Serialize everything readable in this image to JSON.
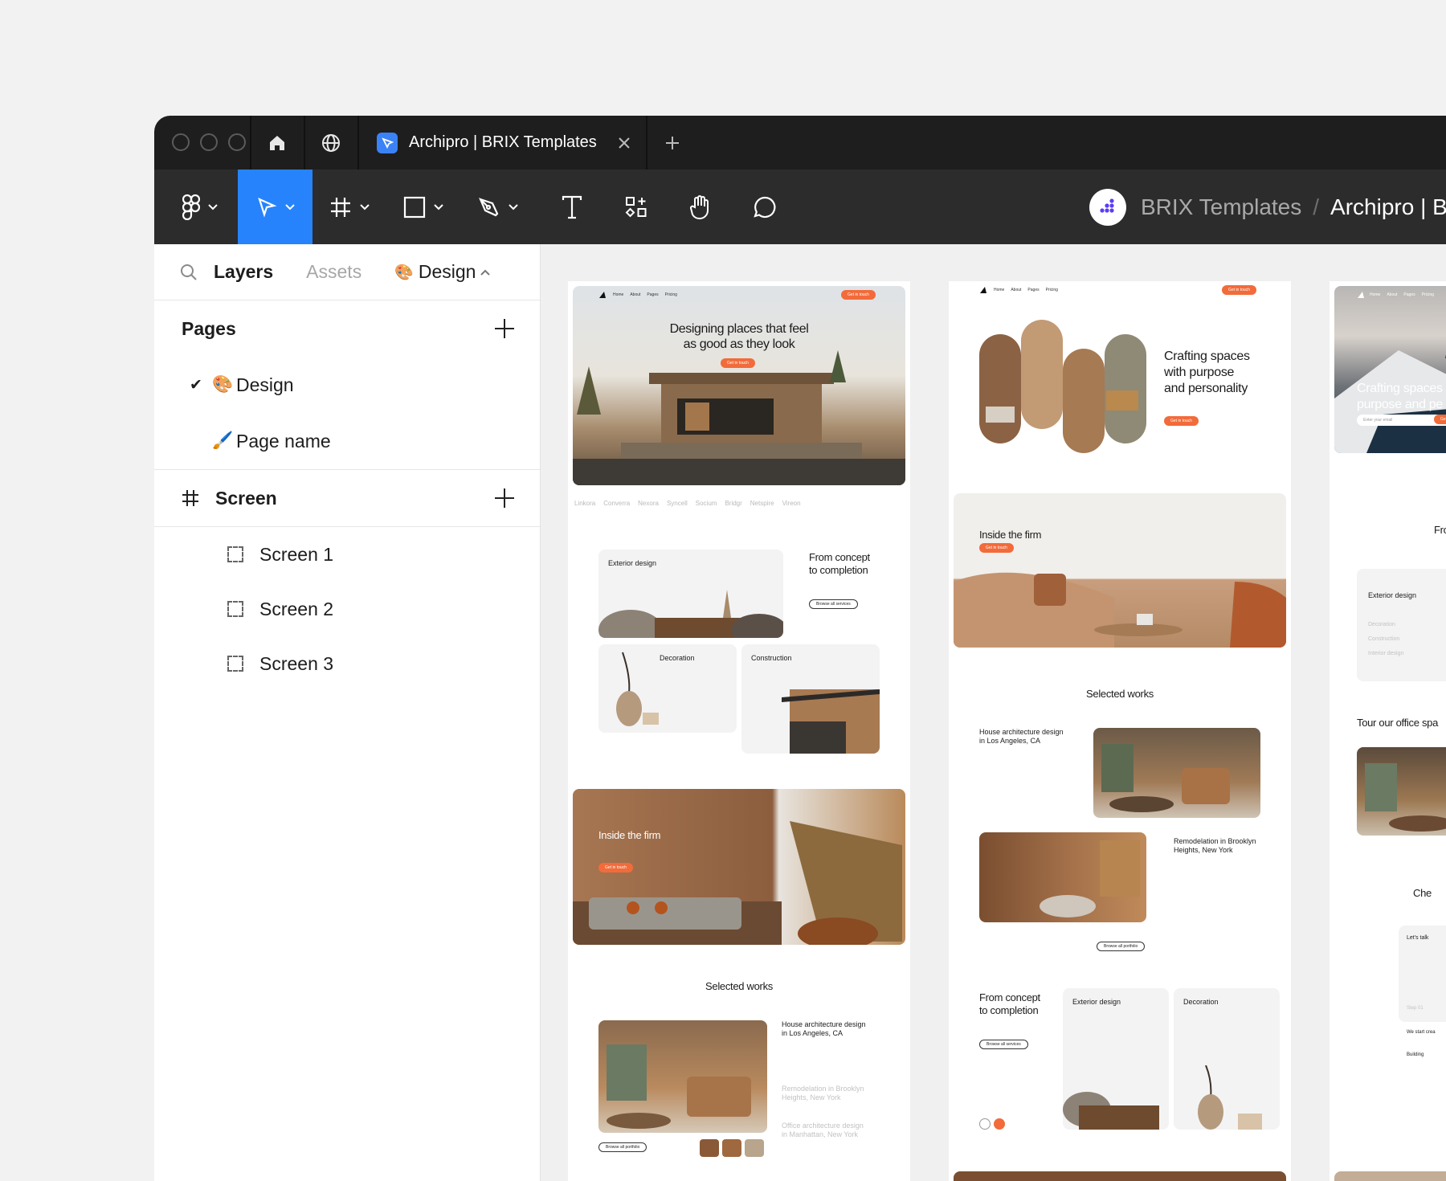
{
  "browser": {
    "tab_title": "Archipro | BRIX Templates"
  },
  "toolbar": {
    "team": "BRIX Templates",
    "separator": "/",
    "file": "Archipro | BR",
    "tools": [
      "figma-menu",
      "move",
      "frame",
      "shape",
      "pen",
      "text",
      "components",
      "hand",
      "comment"
    ]
  },
  "panel": {
    "tabs": {
      "layers": "Layers",
      "assets": "Assets",
      "page": "Design"
    },
    "pages_title": "Pages",
    "pages": [
      {
        "emoji": "🎨",
        "name": "Design",
        "selected": true
      },
      {
        "emoji": "🖌️",
        "name": "Page name",
        "selected": false
      }
    ],
    "frame_title": "Screen",
    "layers": [
      "Screen 1",
      "Screen 2",
      "Screen 3"
    ]
  },
  "colors": {
    "accent": "#2683fb",
    "brand_orange": "#f26b3a",
    "toolbar": "#2c2c2c",
    "tabbar": "#1e1e1e"
  },
  "canvas": {
    "nav": {
      "home": "Home",
      "about": "About",
      "pages": "Pages",
      "pricing": "Pricing",
      "cta": "Get in touch"
    },
    "f1": {
      "hero_title_1": "Designing places that feel",
      "hero_title_2": "as good as they look",
      "logos": [
        "Linkora",
        "Converra",
        "Nexora",
        "Syncell",
        "Socium",
        "Bridgr",
        "Netspire",
        "Vireon"
      ],
      "exterior": "Exterior design",
      "concept_1": "From concept",
      "concept_2": "to completion",
      "browse_services": "Browse all services",
      "decoration": "Decoration",
      "construction": "Construction",
      "firm": "Inside the firm",
      "works": "Selected works",
      "work1_1": "House architecture design",
      "work1_2": "in Los Angeles, CA",
      "work2_1": "Remodelation in Brooklyn",
      "work2_2": "Heights, New York",
      "work3_1": "Office architecture design",
      "work3_2": "in Manhattan, New York",
      "browse_portfolio": "Browse all portfolio"
    },
    "f2": {
      "hero_1": "Crafting spaces",
      "hero_2": "with purpose",
      "hero_3": "and personality",
      "firm": "Inside the firm",
      "works": "Selected works",
      "work1_1": "House architecture design",
      "work1_2": "in Los Angeles, CA",
      "work2_1": "Remodelation in Brooklyn",
      "work2_2": "Heights, New York",
      "browse_portfolio": "Browse all portfolio",
      "concept_1": "From concept",
      "concept_2": "to completion",
      "browse_services": "Browse all services",
      "exterior": "Exterior design",
      "decoration": "Decoration"
    },
    "f3": {
      "hero_1": "Crafting spaces",
      "hero_2": "purpose and pe",
      "email_placeholder": "Enter your email",
      "fro": "Fro",
      "exterior": "Exterior design",
      "decoration": "Decoration",
      "construction": "Construction",
      "interior": "Interior design",
      "tour": "Tour our office spa",
      "che": "Che",
      "lets_talk": "Let's talk",
      "step": "Step 01",
      "we_start": "We start crea",
      "building": "Building"
    }
  }
}
